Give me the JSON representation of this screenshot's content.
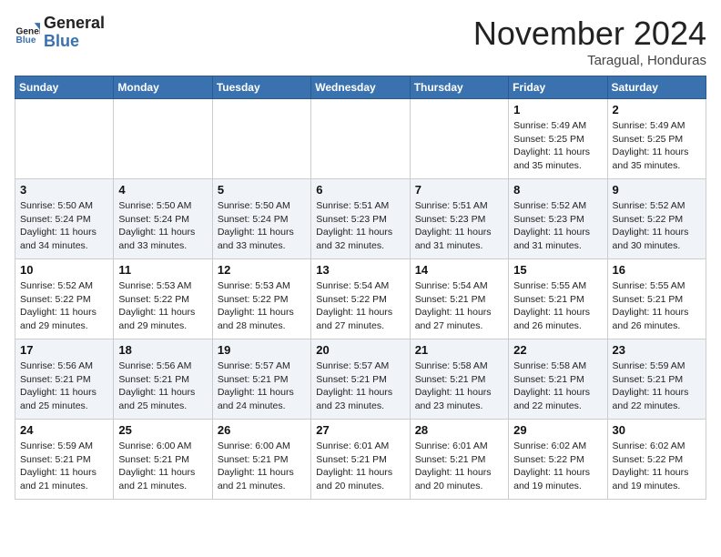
{
  "header": {
    "logo_line1": "General",
    "logo_line2": "Blue",
    "month_title": "November 2024",
    "location": "Taragual, Honduras"
  },
  "weekdays": [
    "Sunday",
    "Monday",
    "Tuesday",
    "Wednesday",
    "Thursday",
    "Friday",
    "Saturday"
  ],
  "weeks": [
    [
      {
        "day": "",
        "info": ""
      },
      {
        "day": "",
        "info": ""
      },
      {
        "day": "",
        "info": ""
      },
      {
        "day": "",
        "info": ""
      },
      {
        "day": "",
        "info": ""
      },
      {
        "day": "1",
        "info": "Sunrise: 5:49 AM\nSunset: 5:25 PM\nDaylight: 11 hours and 35 minutes."
      },
      {
        "day": "2",
        "info": "Sunrise: 5:49 AM\nSunset: 5:25 PM\nDaylight: 11 hours and 35 minutes."
      }
    ],
    [
      {
        "day": "3",
        "info": "Sunrise: 5:50 AM\nSunset: 5:24 PM\nDaylight: 11 hours and 34 minutes."
      },
      {
        "day": "4",
        "info": "Sunrise: 5:50 AM\nSunset: 5:24 PM\nDaylight: 11 hours and 33 minutes."
      },
      {
        "day": "5",
        "info": "Sunrise: 5:50 AM\nSunset: 5:24 PM\nDaylight: 11 hours and 33 minutes."
      },
      {
        "day": "6",
        "info": "Sunrise: 5:51 AM\nSunset: 5:23 PM\nDaylight: 11 hours and 32 minutes."
      },
      {
        "day": "7",
        "info": "Sunrise: 5:51 AM\nSunset: 5:23 PM\nDaylight: 11 hours and 31 minutes."
      },
      {
        "day": "8",
        "info": "Sunrise: 5:52 AM\nSunset: 5:23 PM\nDaylight: 11 hours and 31 minutes."
      },
      {
        "day": "9",
        "info": "Sunrise: 5:52 AM\nSunset: 5:22 PM\nDaylight: 11 hours and 30 minutes."
      }
    ],
    [
      {
        "day": "10",
        "info": "Sunrise: 5:52 AM\nSunset: 5:22 PM\nDaylight: 11 hours and 29 minutes."
      },
      {
        "day": "11",
        "info": "Sunrise: 5:53 AM\nSunset: 5:22 PM\nDaylight: 11 hours and 29 minutes."
      },
      {
        "day": "12",
        "info": "Sunrise: 5:53 AM\nSunset: 5:22 PM\nDaylight: 11 hours and 28 minutes."
      },
      {
        "day": "13",
        "info": "Sunrise: 5:54 AM\nSunset: 5:22 PM\nDaylight: 11 hours and 27 minutes."
      },
      {
        "day": "14",
        "info": "Sunrise: 5:54 AM\nSunset: 5:21 PM\nDaylight: 11 hours and 27 minutes."
      },
      {
        "day": "15",
        "info": "Sunrise: 5:55 AM\nSunset: 5:21 PM\nDaylight: 11 hours and 26 minutes."
      },
      {
        "day": "16",
        "info": "Sunrise: 5:55 AM\nSunset: 5:21 PM\nDaylight: 11 hours and 26 minutes."
      }
    ],
    [
      {
        "day": "17",
        "info": "Sunrise: 5:56 AM\nSunset: 5:21 PM\nDaylight: 11 hours and 25 minutes."
      },
      {
        "day": "18",
        "info": "Sunrise: 5:56 AM\nSunset: 5:21 PM\nDaylight: 11 hours and 25 minutes."
      },
      {
        "day": "19",
        "info": "Sunrise: 5:57 AM\nSunset: 5:21 PM\nDaylight: 11 hours and 24 minutes."
      },
      {
        "day": "20",
        "info": "Sunrise: 5:57 AM\nSunset: 5:21 PM\nDaylight: 11 hours and 23 minutes."
      },
      {
        "day": "21",
        "info": "Sunrise: 5:58 AM\nSunset: 5:21 PM\nDaylight: 11 hours and 23 minutes."
      },
      {
        "day": "22",
        "info": "Sunrise: 5:58 AM\nSunset: 5:21 PM\nDaylight: 11 hours and 22 minutes."
      },
      {
        "day": "23",
        "info": "Sunrise: 5:59 AM\nSunset: 5:21 PM\nDaylight: 11 hours and 22 minutes."
      }
    ],
    [
      {
        "day": "24",
        "info": "Sunrise: 5:59 AM\nSunset: 5:21 PM\nDaylight: 11 hours and 21 minutes."
      },
      {
        "day": "25",
        "info": "Sunrise: 6:00 AM\nSunset: 5:21 PM\nDaylight: 11 hours and 21 minutes."
      },
      {
        "day": "26",
        "info": "Sunrise: 6:00 AM\nSunset: 5:21 PM\nDaylight: 11 hours and 21 minutes."
      },
      {
        "day": "27",
        "info": "Sunrise: 6:01 AM\nSunset: 5:21 PM\nDaylight: 11 hours and 20 minutes."
      },
      {
        "day": "28",
        "info": "Sunrise: 6:01 AM\nSunset: 5:21 PM\nDaylight: 11 hours and 20 minutes."
      },
      {
        "day": "29",
        "info": "Sunrise: 6:02 AM\nSunset: 5:22 PM\nDaylight: 11 hours and 19 minutes."
      },
      {
        "day": "30",
        "info": "Sunrise: 6:02 AM\nSunset: 5:22 PM\nDaylight: 11 hours and 19 minutes."
      }
    ]
  ]
}
